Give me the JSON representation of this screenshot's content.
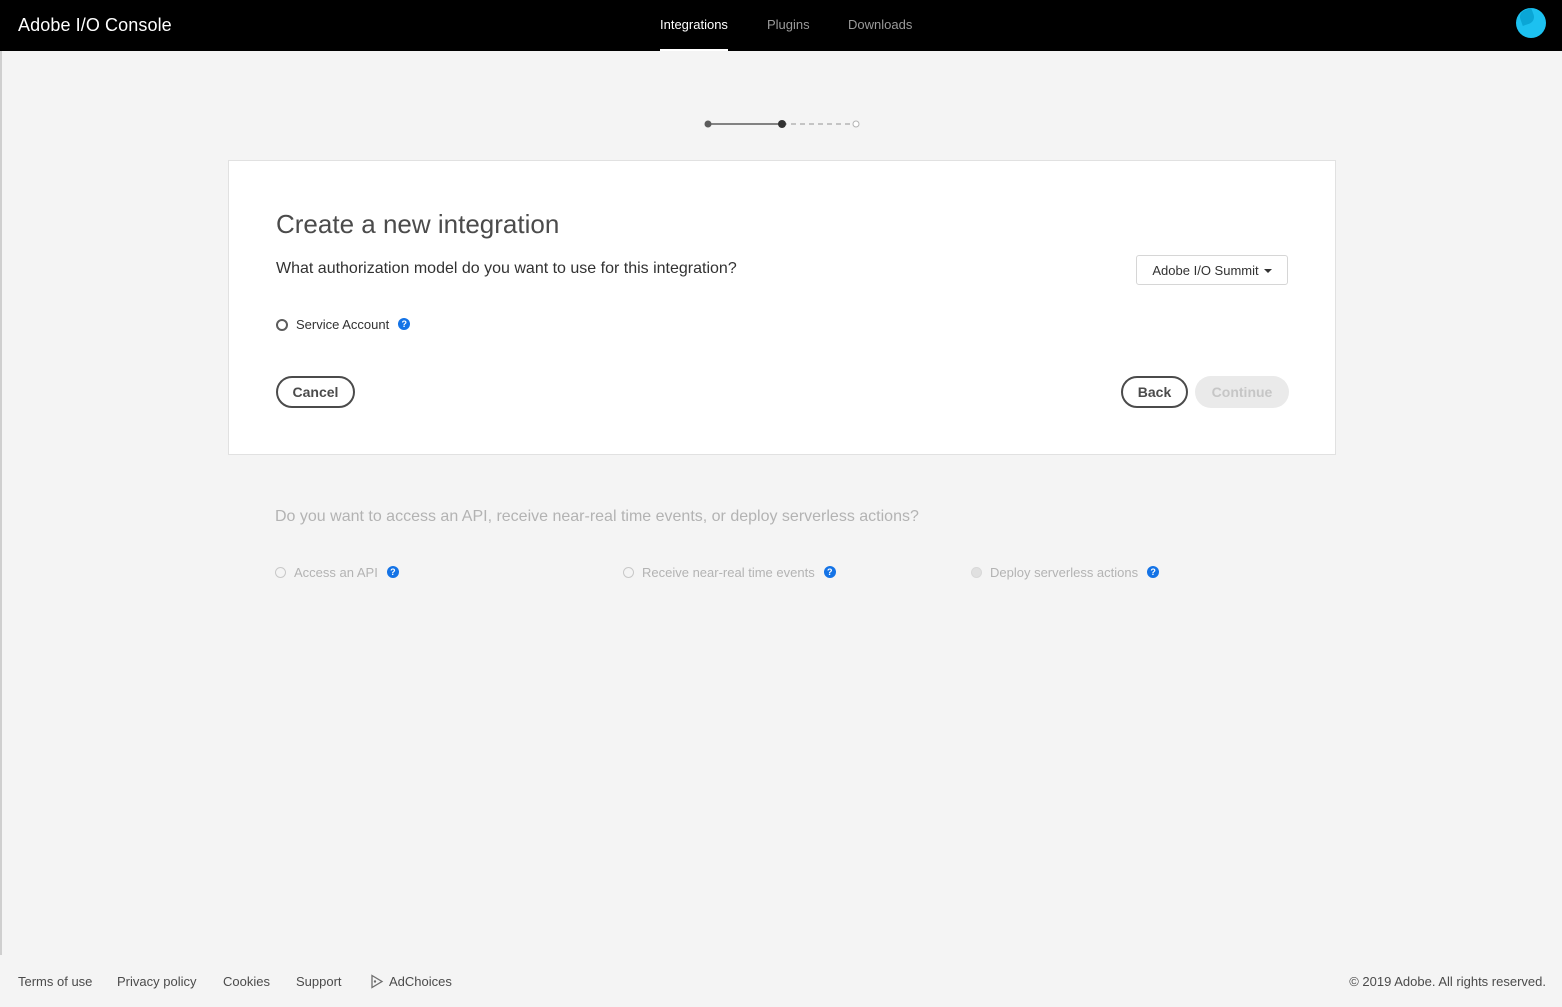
{
  "app": {
    "title": "Adobe I/O Console"
  },
  "nav": {
    "items": [
      {
        "label": "Integrations",
        "active": true
      },
      {
        "label": "Plugins",
        "active": false
      },
      {
        "label": "Downloads",
        "active": false
      }
    ]
  },
  "stepper": {
    "total_steps": 3,
    "current_step": 2
  },
  "integration_form": {
    "title": "Create a new integration",
    "question": "What authorization model do you want to use for this integration?",
    "org_selector": {
      "selected": "Adobe I/O Summit"
    },
    "auth_options": [
      {
        "label": "Service Account",
        "selected": false
      }
    ],
    "buttons": {
      "cancel": "Cancel",
      "back": "Back",
      "continue": "Continue"
    }
  },
  "access_section": {
    "question": "Do you want to access an API, receive near-real time events, or deploy serverless actions?",
    "options": [
      {
        "label": "Access an API"
      },
      {
        "label": "Receive near-real time events"
      },
      {
        "label": "Deploy serverless actions"
      }
    ]
  },
  "footer": {
    "links": [
      "Terms of use",
      "Privacy policy",
      "Cookies",
      "Support",
      "AdChoices"
    ],
    "copyright": "© 2019 Adobe. All rights reserved."
  },
  "icons": {
    "help": "help-question-icon",
    "adchoices": "adchoices-icon",
    "caret": "chevron-down-icon"
  },
  "colors": {
    "topbar": "#000000",
    "accent_help": "#1473e6",
    "page_bg": "#f4f4f4",
    "avatar": "#1cc1f0"
  }
}
